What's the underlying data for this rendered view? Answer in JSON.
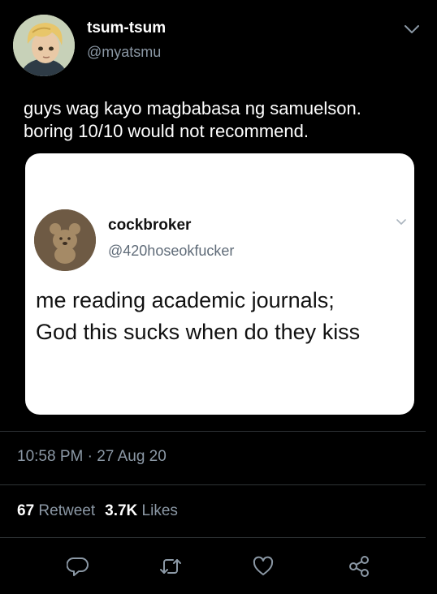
{
  "tweet": {
    "display_name": "tsum-tsum",
    "handle": "@myatsmu",
    "text_line1": "guys wag kayo magbabasa ng samuelson.",
    "text_line2": "boring 10/10 would not recommend."
  },
  "embedded_tweet": {
    "display_name": "cockbroker",
    "handle": "@420hoseokfucker",
    "text_line1": "me reading academic journals;",
    "text_line2": "God this sucks when do they kiss"
  },
  "meta": {
    "timestamp": "10:58 PM · 27 Aug 20",
    "retweet_count": "67",
    "retweet_label": "Retweet",
    "like_count": "3.7K",
    "like_label": "Likes"
  },
  "actions": [
    {
      "icon": "reply-icon"
    },
    {
      "icon": "retweet-icon"
    },
    {
      "icon": "like-icon"
    },
    {
      "icon": "share-icon"
    }
  ],
  "colors": {
    "background": "#000000",
    "text": "#ffffff",
    "secondary_text": "#8b98a5",
    "divider": "#2f3336"
  }
}
